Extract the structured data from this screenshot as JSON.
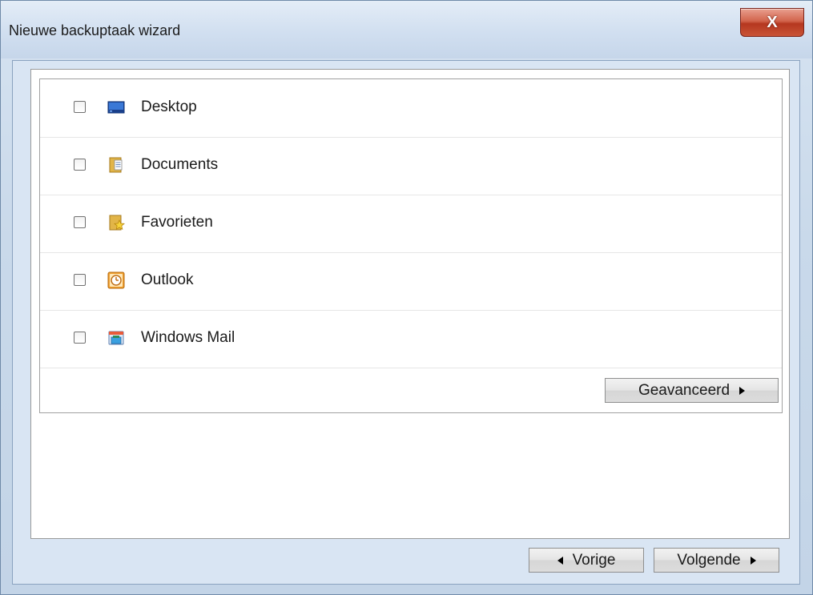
{
  "window": {
    "title": "Nieuwe backuptaak wizard",
    "close_label": "X"
  },
  "items": [
    {
      "label": "Desktop",
      "checked": false,
      "icon": "desktop-icon"
    },
    {
      "label": "Documents",
      "checked": false,
      "icon": "documents-folder-icon"
    },
    {
      "label": "Favorieten",
      "checked": false,
      "icon": "favorites-folder-icon"
    },
    {
      "label": "Outlook",
      "checked": false,
      "icon": "outlook-icon"
    },
    {
      "label": "Windows Mail",
      "checked": false,
      "icon": "windows-mail-icon"
    }
  ],
  "buttons": {
    "advanced": "Geavanceerd",
    "previous": "Vorige",
    "next": "Volgende"
  },
  "colors": {
    "window_frame": "#c9d9ea",
    "close_button": "#c95437",
    "panel_bg": "#ffffff"
  }
}
